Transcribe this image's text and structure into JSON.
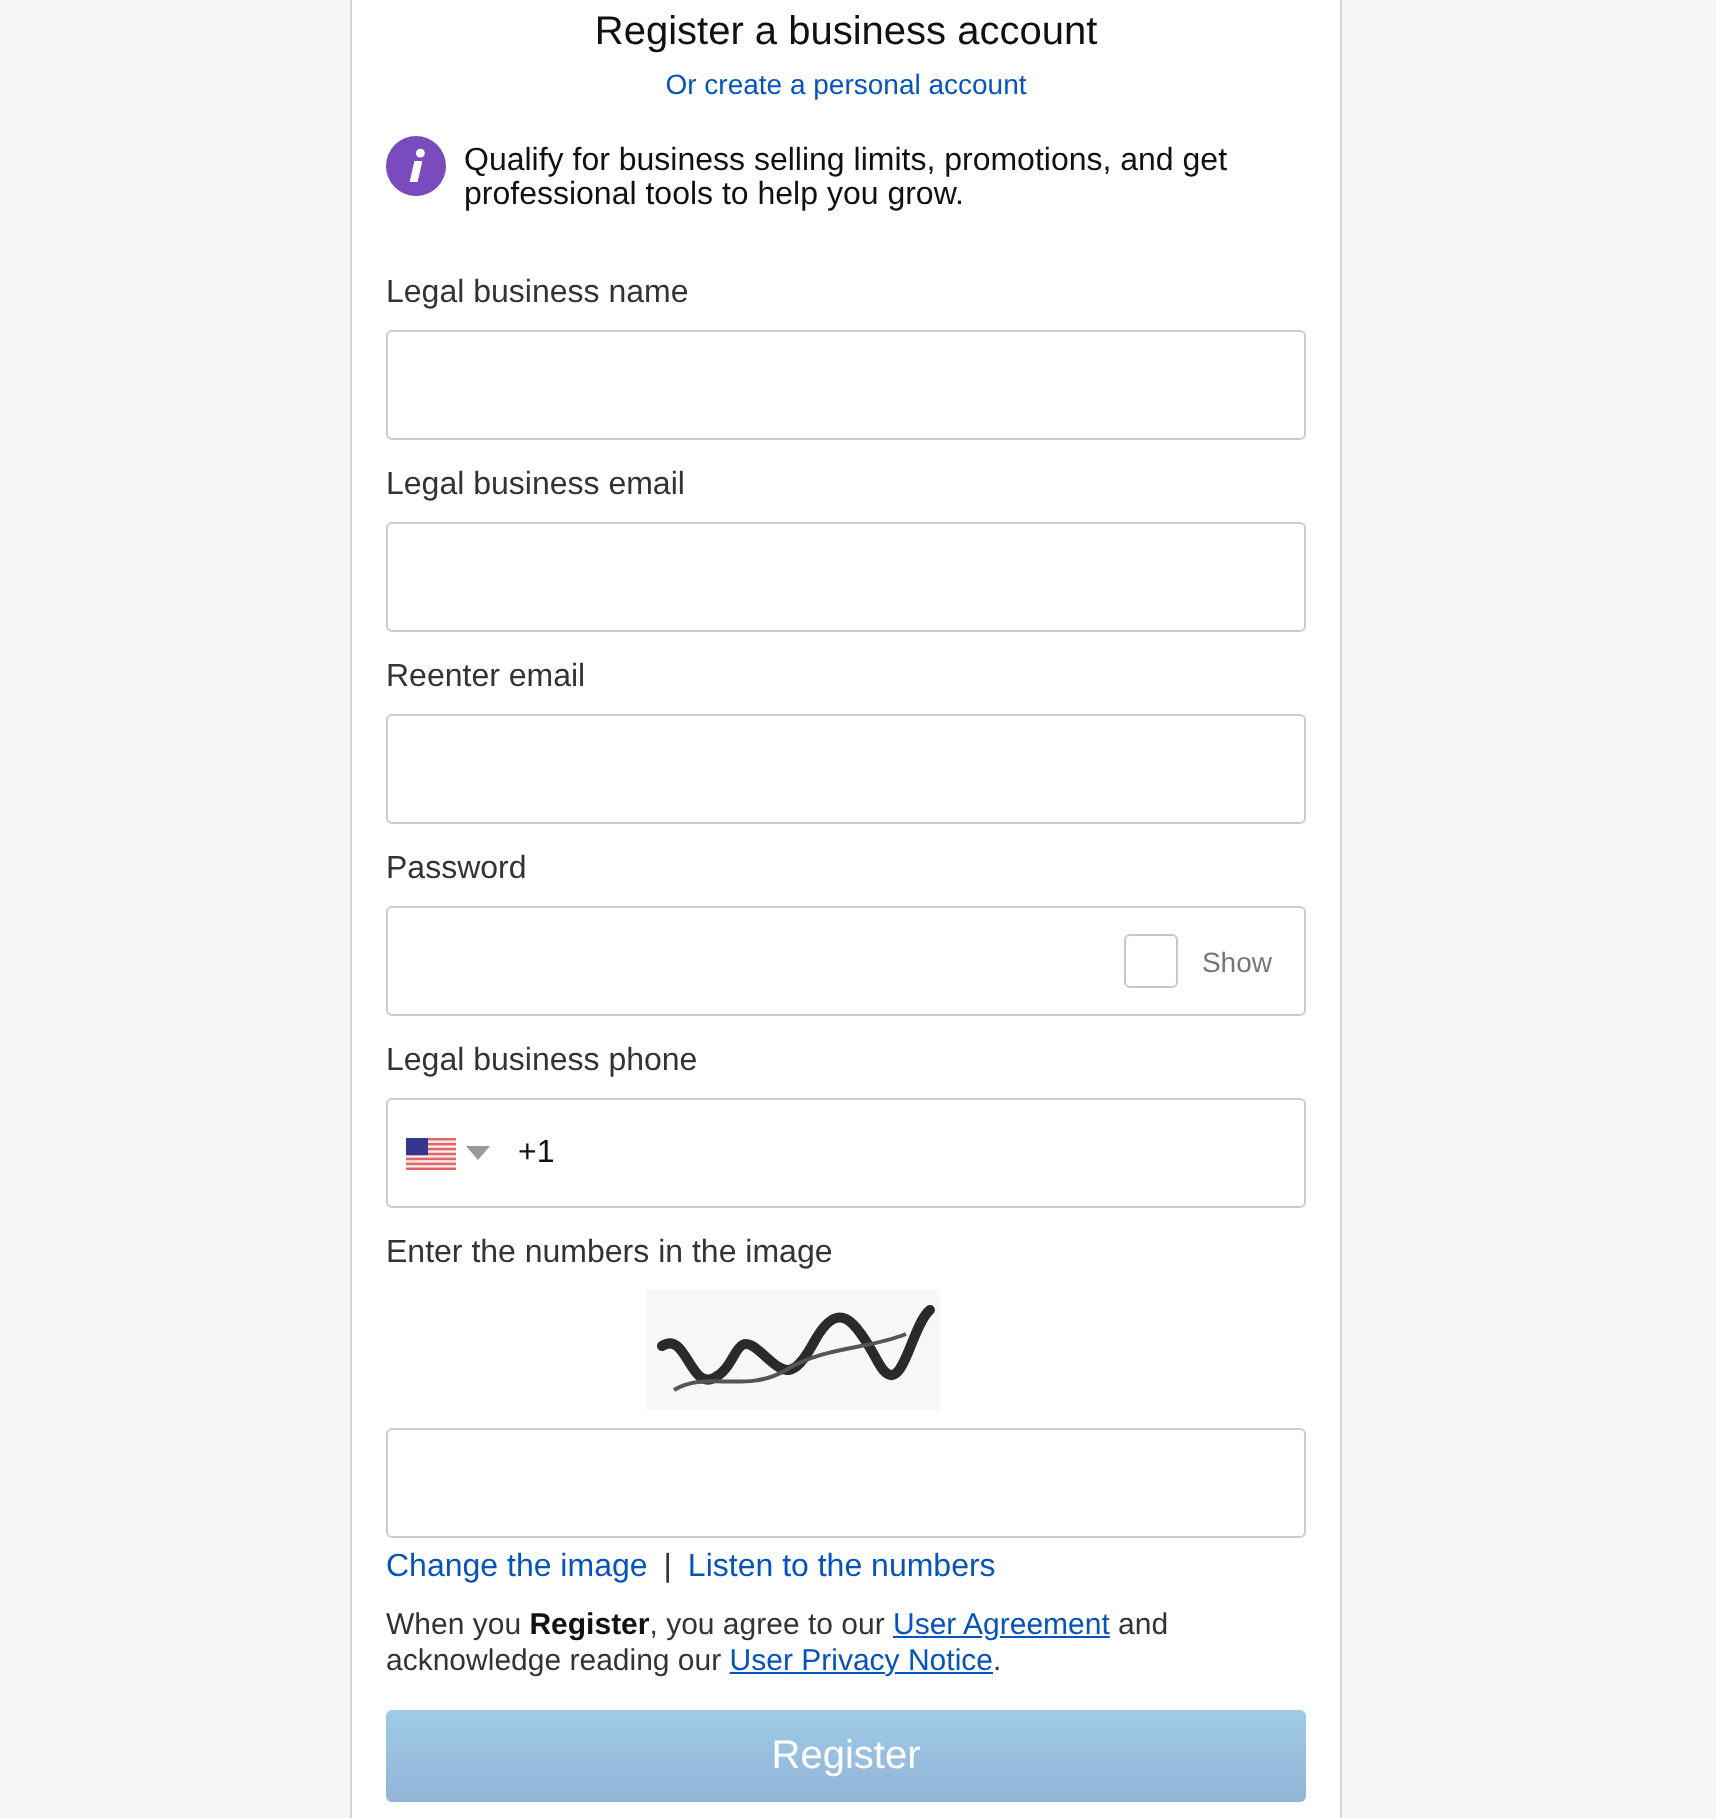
{
  "header": {
    "title": "Register a business account",
    "switch_link": "Or create a personal account"
  },
  "info": {
    "text": "Qualify for business selling limits, promotions, and get professional tools to help you grow."
  },
  "fields": [
    {
      "kind": "text",
      "label": "Legal business name"
    },
    {
      "kind": "text",
      "label": "Legal business email"
    },
    {
      "kind": "text",
      "label": "Reenter email"
    },
    {
      "kind": "password",
      "label": "Password",
      "show_label": "Show",
      "show_checked": false
    },
    {
      "kind": "phone",
      "label": "Legal business phone",
      "country_code": "+1"
    },
    {
      "kind": "captcha",
      "label": "Enter the numbers in the image",
      "links": [
        "Change the image",
        "Listen to the numbers"
      ],
      "separator": "|"
    }
  ],
  "legal": [
    {
      "kind": "text",
      "text": "When you **Register**, you agree to our "
    },
    {
      "kind": "link",
      "text": "User Agreement"
    },
    {
      "kind": "text",
      "text": " and acknowledge reading our "
    },
    {
      "kind": "link",
      "text": "User Privacy Notice"
    },
    {
      "kind": "text",
      "text": "."
    }
  ],
  "register_button": {
    "label": "Register",
    "disabled": true
  }
}
